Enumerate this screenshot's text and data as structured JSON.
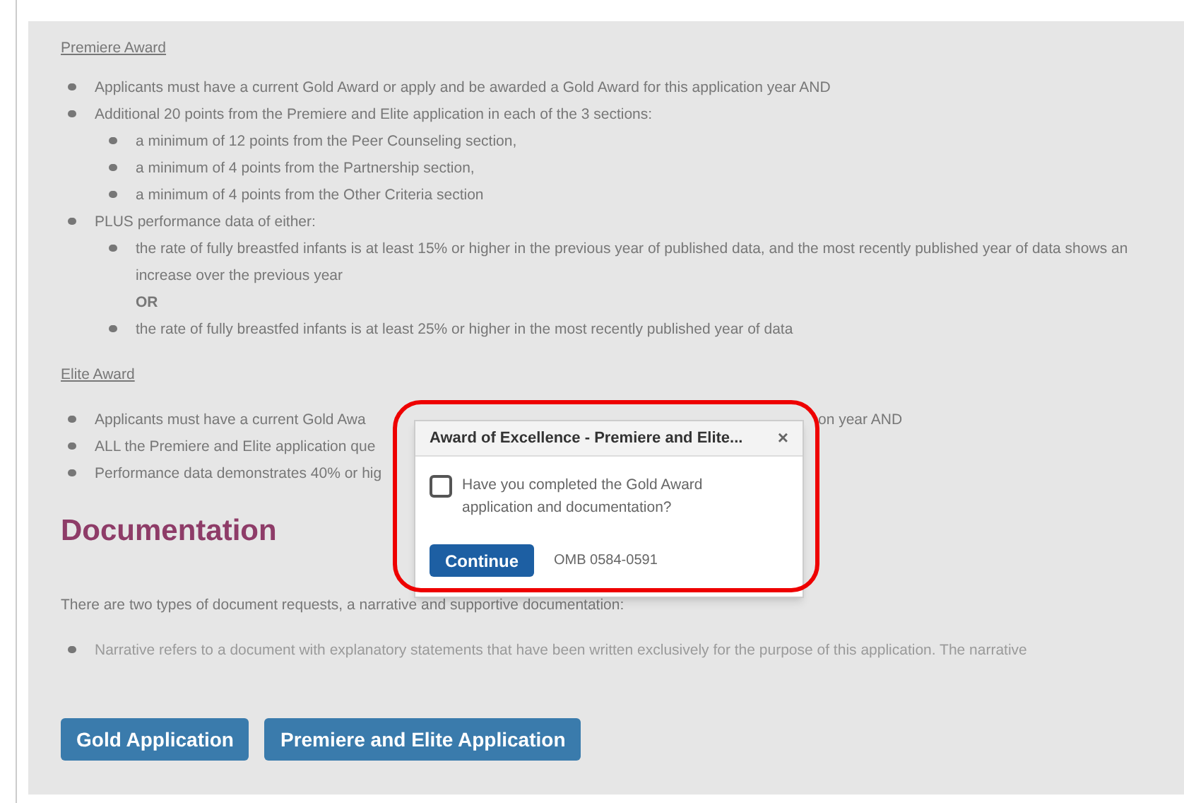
{
  "premiere": {
    "heading": "Premiere Award",
    "items": [
      {
        "text": "Applicants must have a current Gold Award or apply and be awarded a Gold Award for this application year AND"
      },
      {
        "text": "Additional 20 points from the Premiere and Elite application in each of the 3 sections:",
        "children": [
          {
            "text": "a minimum of 12 points from the Peer Counseling section,"
          },
          {
            "text": "a minimum of 4 points from the Partnership section,"
          },
          {
            "text": "a minimum of 4 points from the Other Criteria section"
          }
        ]
      },
      {
        "text": "PLUS performance data of either:",
        "children": [
          {
            "text": "the rate of fully breastfed infants is at least 15% or higher in the previous year of published data, and the most recently published year of data shows an increase over the previous year",
            "after": "OR"
          },
          {
            "text": "the rate of fully breastfed infants is at least 25% or higher in the most recently published year of data"
          }
        ]
      }
    ]
  },
  "elite": {
    "heading": "Elite Award",
    "items": [
      {
        "text": "Applicants must have a current Gold Awa",
        "tail": "on year AND"
      },
      {
        "text": "ALL the Premiere and Elite application que"
      },
      {
        "text": "Performance data demonstrates 40% or hig"
      }
    ]
  },
  "documentation": {
    "heading": "Documentation",
    "intro": "There are two types of document requests, a narrative and supportive documentation:",
    "items": [
      {
        "text": "Narrative refers to a document with explanatory statements that have been written exclusively for the purpose of this application. The narrative"
      }
    ]
  },
  "buttons": [
    "Gold Application",
    "Premiere and Elite Application"
  ],
  "dialog": {
    "title": "Award of Excellence - Premiere and Elite...",
    "close": "×",
    "checkbox": {
      "label": "Have you completed the Gold Award application and documentation?",
      "checked": false
    },
    "button": "Continue",
    "omb": "OMB 0584-0591",
    "highlighted": true
  }
}
